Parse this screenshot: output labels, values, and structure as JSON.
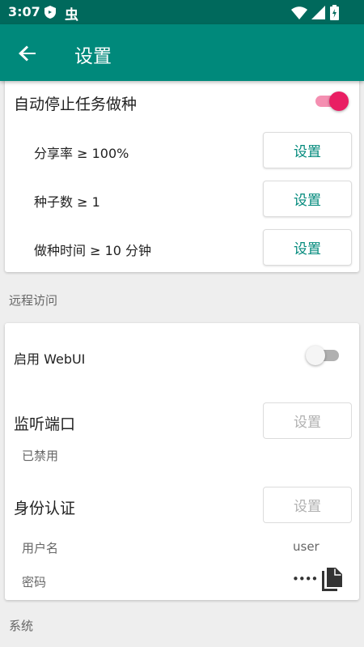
{
  "status_bar": {
    "time": "3:07",
    "notification_icons": [
      "shield-icon",
      "bug-icon"
    ],
    "system_icons": [
      "wifi-icon",
      "signal-icon",
      "battery-icon"
    ]
  },
  "app_bar": {
    "title": "设置",
    "back_icon": "arrow-left-icon",
    "background": "#00897b",
    "status_background": "#00695c"
  },
  "auto_stop": {
    "label": "自动停止任务做种",
    "enabled": true,
    "items": [
      {
        "label": "分享率 ≥ 100%",
        "button": "设置"
      },
      {
        "label": "种子数 ≥ 1",
        "button": "设置"
      },
      {
        "label": "做种时间 ≥ 10 分钟",
        "button": "设置"
      }
    ]
  },
  "remote_access": {
    "section_title": "远程访问",
    "webui_label": "启用 WebUI",
    "webui_enabled": false,
    "port": {
      "label": "监听端口",
      "button": "设置",
      "status": "已禁用"
    },
    "auth": {
      "label": "身份认证",
      "button": "设置",
      "username_label": "用户名",
      "username_value": "user",
      "password_label": "密码",
      "password_value": "••••",
      "copy_icon": "copy-icon"
    }
  },
  "system": {
    "section_title": "系统"
  },
  "colors": {
    "accent": "#00897b",
    "switch_on": "#e91e63",
    "switch_on_track": "#f48fb1",
    "disabled_text": "#b0b0b0"
  }
}
